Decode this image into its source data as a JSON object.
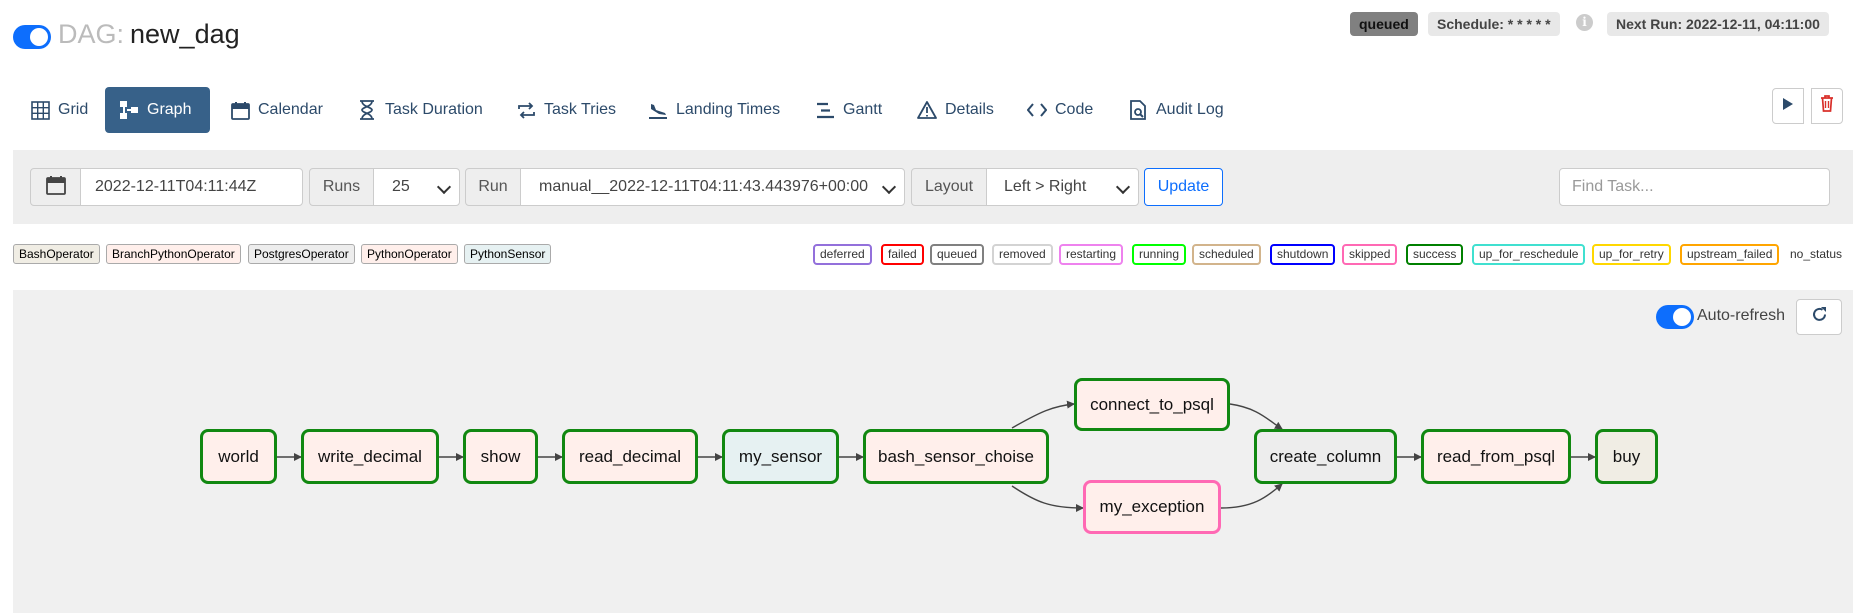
{
  "header": {
    "dag_prefix": "DAG:",
    "dag_name": "new_dag",
    "state_badge": "queued",
    "schedule": "Schedule: * * * * *",
    "next_run": "Next Run: 2022-12-11, 04:11:00",
    "info_icon": "i"
  },
  "tabs": [
    {
      "label": "Grid",
      "icon": "grid-icon"
    },
    {
      "label": "Graph",
      "icon": "graph-icon",
      "active": true
    },
    {
      "label": "Calendar",
      "icon": "calendar-icon"
    },
    {
      "label": "Task Duration",
      "icon": "hourglass-icon"
    },
    {
      "label": "Task Tries",
      "icon": "retry-icon"
    },
    {
      "label": "Landing Times",
      "icon": "landing-icon"
    },
    {
      "label": "Gantt",
      "icon": "gantt-icon"
    },
    {
      "label": "Details",
      "icon": "warning-triangle-icon"
    },
    {
      "label": "Code",
      "icon": "code-icon"
    },
    {
      "label": "Audit Log",
      "icon": "audit-log-icon"
    }
  ],
  "filters": {
    "base_date": "2022-12-11T04:11:44Z",
    "runs_label": "Runs",
    "runs_value": "25",
    "run_label": "Run",
    "run_value": "manual__2022-12-11T04:11:43.443976+00:00",
    "layout_label": "Layout",
    "layout_value": "Left > Right",
    "update_label": "Update",
    "find_placeholder": "Find Task..."
  },
  "operators": [
    {
      "label": "BashOperator",
      "color": "#f0ede4"
    },
    {
      "label": "BranchPythonOperator",
      "color": "#ffefeb"
    },
    {
      "label": "PostgresOperator",
      "color": "#ededed"
    },
    {
      "label": "PythonOperator",
      "color": "#ffefeb"
    },
    {
      "label": "PythonSensor",
      "color": "#e6f1f2"
    }
  ],
  "states": [
    {
      "label": "deferred",
      "color": "#9370db"
    },
    {
      "label": "failed",
      "color": "#ff0000"
    },
    {
      "label": "queued",
      "color": "#808080"
    },
    {
      "label": "removed",
      "color": "#d3d3d3"
    },
    {
      "label": "restarting",
      "color": "#ee82ee"
    },
    {
      "label": "running",
      "color": "#00ff00"
    },
    {
      "label": "scheduled",
      "color": "#d2b48c"
    },
    {
      "label": "shutdown",
      "color": "#0000ff"
    },
    {
      "label": "skipped",
      "color": "#ff69b4"
    },
    {
      "label": "success",
      "color": "#008000"
    },
    {
      "label": "up_for_reschedule",
      "color": "#40e0d0"
    },
    {
      "label": "up_for_retry",
      "color": "#ffd700"
    },
    {
      "label": "upstream_failed",
      "color": "#ffa500"
    },
    {
      "label": "no_status",
      "color": ""
    }
  ],
  "graph": {
    "auto_refresh_label": "Auto-refresh",
    "nodes": [
      {
        "id": "world",
        "fill": "#ffefeb",
        "border": "#118811"
      },
      {
        "id": "write_decimal",
        "fill": "#ffefeb",
        "border": "#118811"
      },
      {
        "id": "show",
        "fill": "#ffefeb",
        "border": "#118811"
      },
      {
        "id": "read_decimal",
        "fill": "#ffefeb",
        "border": "#118811"
      },
      {
        "id": "my_sensor",
        "fill": "#e6f1f2",
        "border": "#118811"
      },
      {
        "id": "bash_sensor_choise",
        "fill": "#ffefeb",
        "border": "#118811"
      },
      {
        "id": "connect_to_psql",
        "fill": "#ffefeb",
        "border": "#118811"
      },
      {
        "id": "my_exception",
        "fill": "#ffefeb",
        "border": "#ff69b4"
      },
      {
        "id": "create_column",
        "fill": "#ededed",
        "border": "#118811"
      },
      {
        "id": "read_from_psql",
        "fill": "#ffefeb",
        "border": "#118811"
      },
      {
        "id": "buy",
        "fill": "#f0ede4",
        "border": "#118811"
      }
    ]
  }
}
